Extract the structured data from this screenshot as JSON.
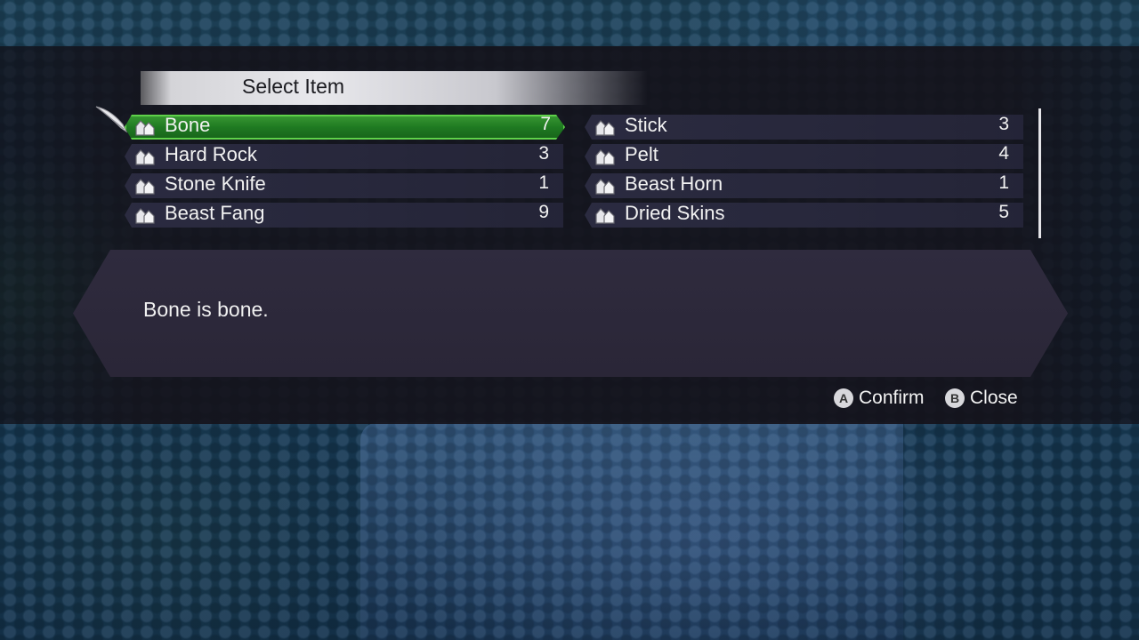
{
  "title": "Select Item",
  "items_left": [
    {
      "name": "Bone",
      "qty": "7",
      "icon": "material-icon",
      "selected": true
    },
    {
      "name": "Hard Rock",
      "qty": "3",
      "icon": "material-icon"
    },
    {
      "name": "Stone Knife",
      "qty": "1",
      "icon": "material-icon"
    },
    {
      "name": "Beast Fang",
      "qty": "9",
      "icon": "material-icon"
    }
  ],
  "items_right": [
    {
      "name": "Stick",
      "qty": "3",
      "icon": "material-icon"
    },
    {
      "name": "Pelt",
      "qty": "4",
      "icon": "material-icon"
    },
    {
      "name": "Beast Horn",
      "qty": "1",
      "icon": "material-icon"
    },
    {
      "name": "Dried Skins",
      "qty": "5",
      "icon": "material-icon"
    }
  ],
  "description": "Bone is bone.",
  "prompts": [
    {
      "button": "A",
      "label": "Confirm"
    },
    {
      "button": "B",
      "label": "Close"
    }
  ],
  "colors": {
    "selected_row": "#1f7a22",
    "selected_border": "#5fd14a",
    "row_bg": "#2c2c42",
    "panel_bg": "#2f2b3e"
  }
}
